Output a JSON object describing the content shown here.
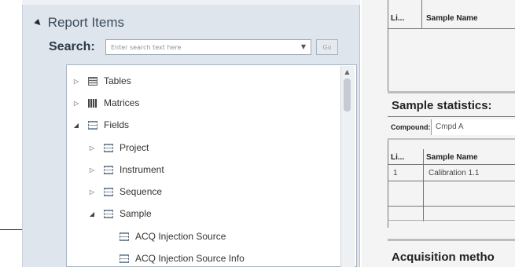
{
  "report_items": {
    "section_label": "Report Items",
    "search_label": "Search:",
    "search_placeholder": "Enter search text here",
    "go_label": "Go",
    "tree": [
      {
        "label": "Tables",
        "expander": "▷",
        "icon": "table-icon"
      },
      {
        "label": "Matrices",
        "expander": "▷",
        "icon": "matrix-icon"
      },
      {
        "label": "Fields",
        "expander": "◢",
        "icon": "field-icon"
      },
      {
        "label": "Project",
        "expander": "▷",
        "icon": "field-icon"
      },
      {
        "label": "Instrument",
        "expander": "▷",
        "icon": "field-icon"
      },
      {
        "label": "Sequence",
        "expander": "▷",
        "icon": "field-icon"
      },
      {
        "label": "Sample",
        "expander": "◢",
        "icon": "field-icon"
      },
      {
        "label": "ACQ Injection Source",
        "expander": "",
        "icon": "field-icon"
      },
      {
        "label": "ACQ Injection Source Info",
        "expander": "",
        "icon": "field-icon"
      }
    ]
  },
  "preview": {
    "top_header_col1": "Li...",
    "top_header_col2": "Sample Name",
    "stats_title": "Sample statistics:",
    "compound_label": "Compound:",
    "compound_value": "Cmpd A",
    "header_col1": "Li...",
    "header_col2": "Sample Name",
    "row_col1": "1",
    "row_col2": "Calibration 1.1",
    "bottom_title": "Acquisition metho"
  }
}
